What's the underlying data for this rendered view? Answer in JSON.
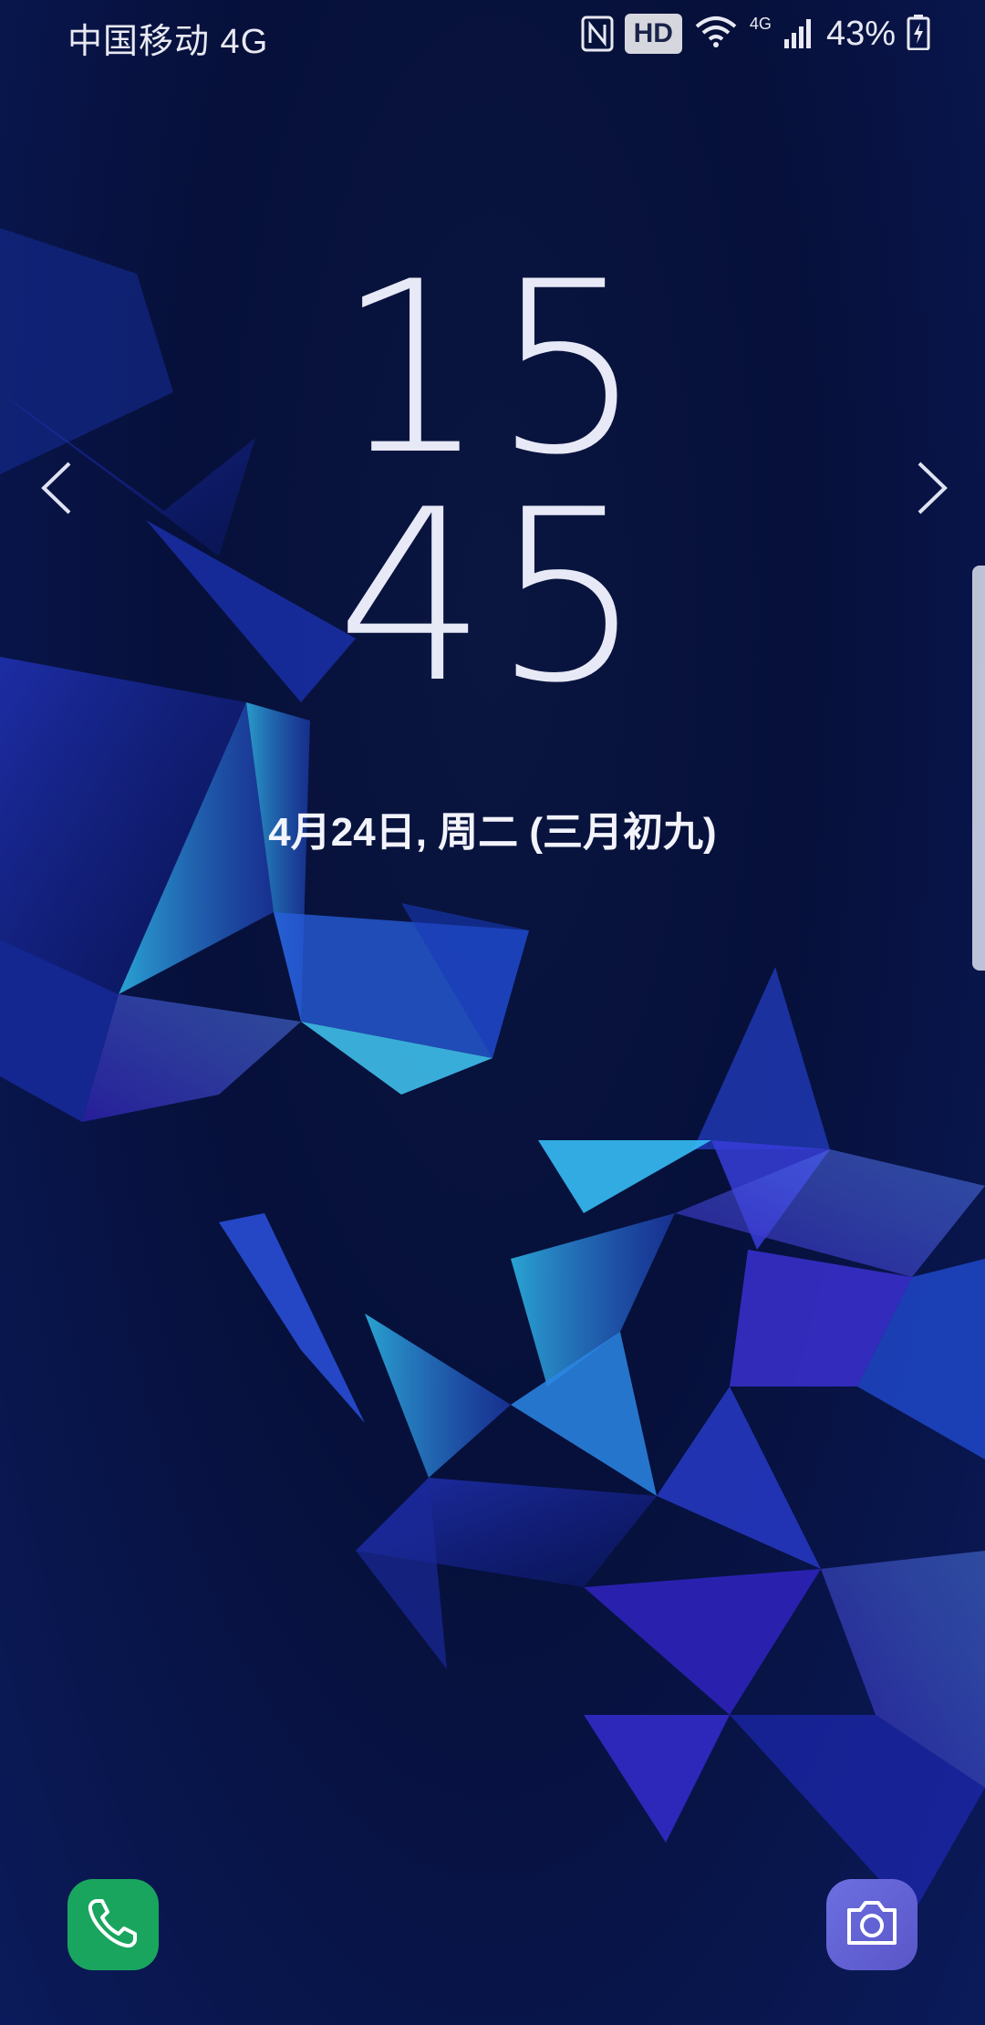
{
  "status_bar": {
    "carrier": "中国移动 4G",
    "nfc_icon": "nfc-icon",
    "hd_label": "HD",
    "wifi_icon": "wifi-icon",
    "network_label": "4G",
    "signal_icon": "signal-icon",
    "battery_percent": "43%",
    "battery_icon": "battery-charging-icon"
  },
  "lockscreen": {
    "hour": "15",
    "minute": "45",
    "date": "4月24日, 周二 (三月初九)",
    "left_arrow_icon": "chevron-left-icon",
    "right_arrow_icon": "chevron-right-icon"
  },
  "shortcuts": {
    "phone_icon": "phone-icon",
    "camera_icon": "camera-icon",
    "phone_color": "#1aa55e",
    "camera_color": "#6366d8"
  },
  "theme": {
    "background": "#06103a",
    "accent": "#3fb8ff"
  }
}
